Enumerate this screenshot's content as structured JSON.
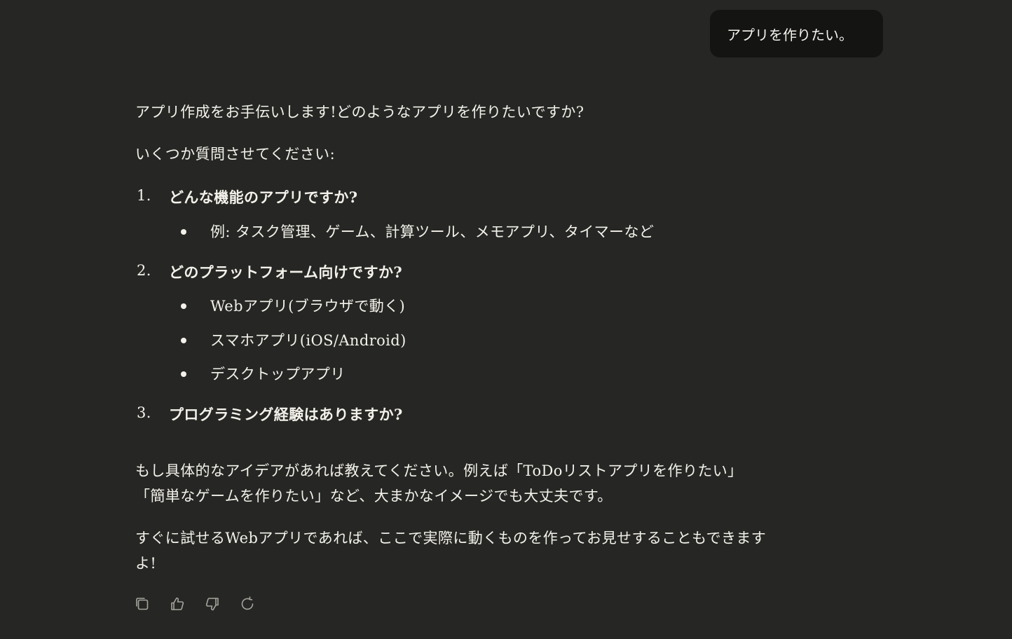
{
  "user_message": "アプリを作りたい。",
  "response": {
    "intro": "アプリ作成をお手伝いします!どのようなアプリを作りたいですか?",
    "lead": "いくつか質問させてください:",
    "questions": [
      {
        "number": "1.",
        "text": "どんな機能のアプリですか?",
        "bullets": [
          "例: タスク管理、ゲーム、計算ツール、メモアプリ、タイマーなど"
        ]
      },
      {
        "number": "2.",
        "text": "どのプラットフォーム向けですか?",
        "bullets": [
          "Webアプリ(ブラウザで動く)",
          "スマホアプリ(iOS/Android)",
          "デスクトップアプリ"
        ]
      },
      {
        "number": "3.",
        "text": "プログラミング経験はありますか?",
        "bullets": []
      }
    ],
    "para1_line1": "もし具体的なアイデアがあれば教えてください。例えば「ToDoリストアプリを作りたい」",
    "para1_line2": "「簡単なゲームを作りたい」など、大まかなイメージでも大丈夫です。",
    "para2_line1": "すぐに試せるWebアプリであれば、ここで実際に動くものを作ってお見せすることもできます",
    "para2_line2": "よ!"
  },
  "actions": [
    {
      "icon": "copy-icon"
    },
    {
      "icon": "thumbs-up-icon"
    },
    {
      "icon": "thumbs-down-icon"
    },
    {
      "icon": "retry-icon"
    }
  ],
  "colors": {
    "background": "#262624",
    "user_bubble": "#141413",
    "text": "#f3f1ea",
    "icon": "#a6a49d"
  }
}
